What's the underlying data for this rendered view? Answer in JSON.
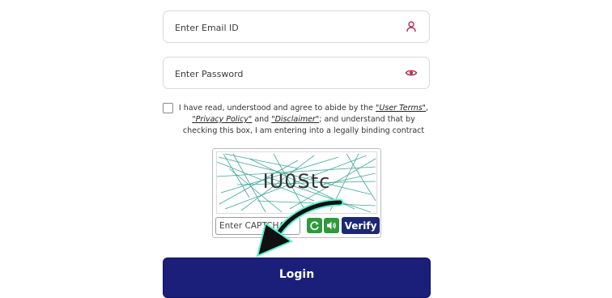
{
  "form": {
    "email_placeholder": "Enter Email ID",
    "password_placeholder": "Enter Password",
    "user_icon": "user-icon",
    "eye_icon": "eye-icon"
  },
  "terms": {
    "text_1": "I have read, understood and agree to abide by the ",
    "link_user_terms": "\"User Terms\"",
    "comma": ",",
    "link_privacy": "\"Privacy Policy\"",
    "and": " and ",
    "link_disclaimer": "\"Disclaimer\"",
    "text_2": "; and understand that by checking this box, I am entering into a legally binding contract"
  },
  "captcha": {
    "code": "IU0Stc",
    "input_placeholder": "Enter CAPTCHA",
    "refresh_icon": "refresh-icon",
    "audio_icon": "speaker-icon",
    "verify_label": "Verify"
  },
  "login": {
    "label": "Login"
  },
  "colors": {
    "accent": "#1b1f7a",
    "icon": "#b0304f",
    "captcha_noise": "#2a9d8f",
    "green_button": "#2e9a3c"
  }
}
